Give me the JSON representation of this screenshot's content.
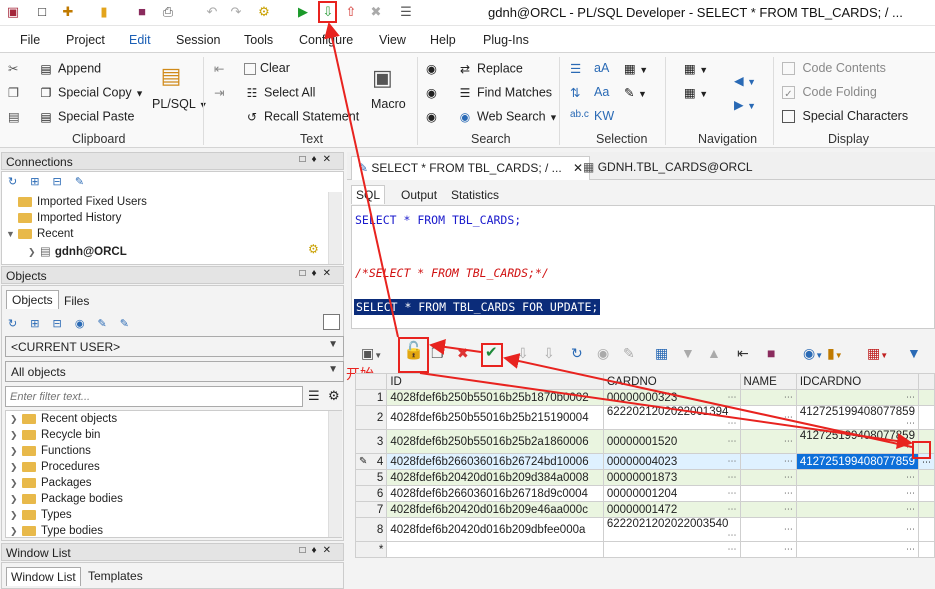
{
  "window": {
    "title": "gdnh@ORCL - PL/SQL Developer - SELECT * FROM TBL_CARDS; / ..."
  },
  "menu": [
    "File",
    "Project",
    "Edit",
    "Session",
    "Tools",
    "Configure",
    "View",
    "Help",
    "Plug-Ins"
  ],
  "ribbon": {
    "clipboard": {
      "append": "Append",
      "special_copy": "Special Copy",
      "special_paste": "Special Paste",
      "plsql": "PL/SQL",
      "group": "Clipboard"
    },
    "text": {
      "clear": "Clear",
      "select_all": "Select All",
      "recall": "Recall Statement",
      "macro": "Macro",
      "group": "Text"
    },
    "search": {
      "replace": "Replace",
      "find_matches": "Find Matches",
      "web_search": "Web Search",
      "group": "Search"
    },
    "selection": {
      "group": "Selection"
    },
    "navigation": {
      "group": "Navigation"
    },
    "display": {
      "code_contents": "Code Contents",
      "code_folding": "Code Folding",
      "special_chars": "Special Characters",
      "group": "Display"
    }
  },
  "connections": {
    "title": "Connections",
    "items": [
      {
        "label": "Imported Fixed Users"
      },
      {
        "label": "Imported History"
      },
      {
        "label": "Recent"
      },
      {
        "label": "gdnh@ORCL"
      }
    ]
  },
  "objects": {
    "title": "Objects",
    "tabs": [
      "Objects",
      "Files"
    ],
    "user_combo": "<CURRENT USER>",
    "type_combo": "All objects",
    "filter_placeholder": "Enter filter text...",
    "tree": [
      "Recent objects",
      "Recycle bin",
      "Functions",
      "Procedures",
      "Packages",
      "Package bodies",
      "Types",
      "Type bodies"
    ]
  },
  "window_list": {
    "title": "Window List",
    "tabs": [
      "Window List",
      "Templates"
    ]
  },
  "editor": {
    "tabs": [
      "SELECT * FROM TBL_CARDS; / ...",
      "GDNH.TBL_CARDS@ORCL"
    ],
    "subtabs": [
      "SQL",
      "Output",
      "Statistics"
    ],
    "lines": {
      "l1_kw1": "SELECT",
      "l1_rest": " * ",
      "l1_kw2": "FROM",
      "l1_tbl": " TBL_CARDS;",
      "l2": "/*SELECT * FROM TBL_CARDS;*/",
      "l3": "SELECT * FROM TBL_CARDS FOR UPDATE;"
    }
  },
  "annotation": {
    "start_label": "开始"
  },
  "grid": {
    "columns": [
      "ID",
      "CARDNO",
      "NAME",
      "IDCARDNO"
    ],
    "rows": [
      {
        "n": "1",
        "id": "4028fdef6b250b55016b25b1870b0002",
        "cardno": "00000000323",
        "name": "",
        "idcardno": ""
      },
      {
        "n": "2",
        "id": "4028fdef6b250b55016b25b215190004",
        "cardno": "6222021202022001394",
        "name": "",
        "idcardno": "412725199408077859"
      },
      {
        "n": "3",
        "id": "4028fdef6b250b55016b25b2a1860006",
        "cardno": "00000001520",
        "name": "",
        "idcardno": "412725199408077859"
      },
      {
        "n": "4",
        "id": "4028fdef6b266036016b26724bd10006",
        "cardno": "00000004023",
        "name": "",
        "idcardno": "412725199408077859"
      },
      {
        "n": "5",
        "id": "4028fdef6b20420d016b209d384a0008",
        "cardno": "00000001873",
        "name": "",
        "idcardno": ""
      },
      {
        "n": "6",
        "id": "4028fdef6b266036016b26718d9c0004",
        "cardno": "00000001204",
        "name": "",
        "idcardno": ""
      },
      {
        "n": "7",
        "id": "4028fdef6b20420d016b209e46aa000c",
        "cardno": "00000001472",
        "name": "",
        "idcardno": ""
      },
      {
        "n": "8",
        "id": "4028fdef6b20420d016b209dbfee000a",
        "cardno": "6222021202022003540",
        "name": "",
        "idcardno": ""
      }
    ],
    "new_row_marker": "*"
  }
}
